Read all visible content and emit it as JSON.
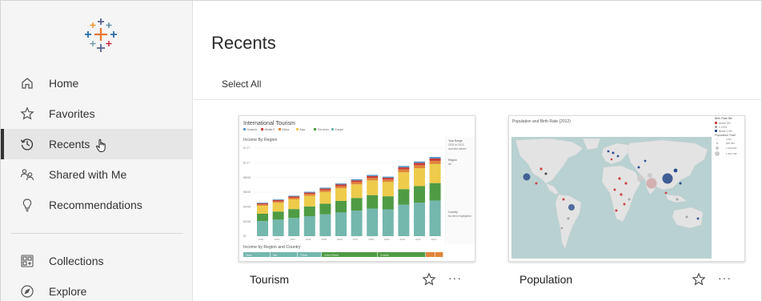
{
  "sidebar": {
    "items": [
      {
        "label": "Home",
        "icon": "home-icon"
      },
      {
        "label": "Favorites",
        "icon": "star-outline-icon"
      },
      {
        "label": "Recents",
        "icon": "clock-history-icon",
        "active": true
      },
      {
        "label": "Shared with Me",
        "icon": "shared-users-icon"
      },
      {
        "label": "Recommendations",
        "icon": "lightbulb-icon"
      },
      {
        "label": "Collections",
        "icon": "collections-icon"
      },
      {
        "label": "Explore",
        "icon": "compass-icon"
      }
    ]
  },
  "main": {
    "title": "Recents",
    "select_all": "Select All",
    "cards": [
      {
        "name": "Tourism",
        "thumbnail": {
          "title": "International Tourism",
          "subtitle": "Income By Region",
          "lower_title": "Income by Region and Country",
          "legend": [
            "Oceania",
            "Middle E",
            "Africa",
            "Asia",
            "The Amer",
            "Europe"
          ],
          "side_labels": [
            "Year Range",
            "2001 to 2012",
            "and last values",
            "Region",
            "All",
            "Country",
            "No items highlighted"
          ],
          "y_ticks": [
            "$1.2T",
            "$1.0T",
            "$800B",
            "$600B",
            "$400B",
            "$200B",
            "$0"
          ],
          "x_ticks": [
            "2001",
            "2002",
            "2003",
            "2004",
            "2005",
            "2006",
            "2007",
            "2008",
            "2009",
            "2010",
            "2011",
            "2012"
          ],
          "lower_bar_labels": [
            "Spain",
            "Italy",
            "Turkey",
            "United States",
            "Canada"
          ]
        }
      },
      {
        "name": "Population",
        "thumbnail": {
          "title": "Population and Birth Rate (2012)",
          "legend_title": "Birth Rate Bin",
          "legend_items": [
            "Above 3%",
            "1-3.5%",
            "Below 1.5%"
          ],
          "size_title": "Population Total",
          "size_items": [
            "0.5M",
            "500,000",
            "1,000,000",
            "1,382,798"
          ]
        }
      }
    ]
  },
  "colors": {
    "sidebar_bg": "#f5f5f5",
    "active_bg": "#e6e6e6",
    "series": [
      "#5b97c8",
      "#c93c36",
      "#e0853a",
      "#eecb4a",
      "#4f9b44",
      "#74b7ad"
    ],
    "map_ocean": "#b9d1d1",
    "map_land": "#e3e3e3"
  }
}
